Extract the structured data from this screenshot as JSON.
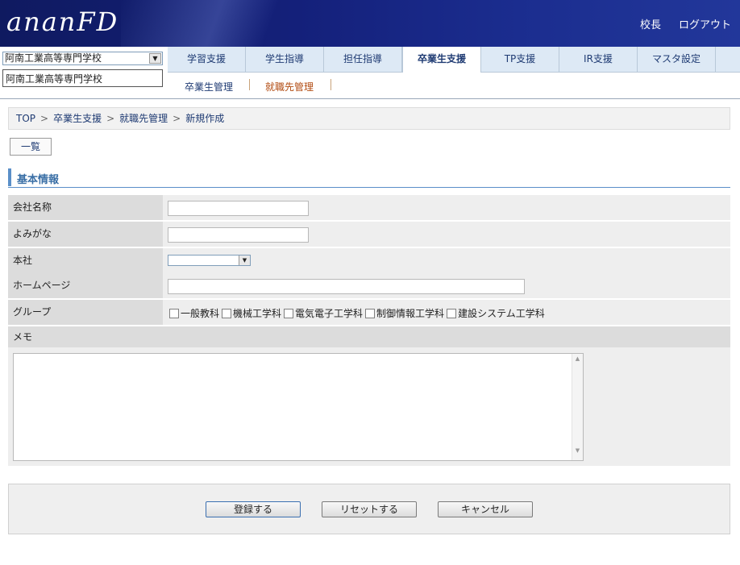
{
  "header": {
    "logo": "ananFD",
    "links": {
      "principal": "校長",
      "logout": "ログアウト"
    }
  },
  "school": {
    "select_value": "阿南工業高等専門学校",
    "name": "阿南工業高等専門学校"
  },
  "tabs": [
    "学習支援",
    "学生指導",
    "担任指導",
    "卒業生支援",
    "TP支援",
    "IR支援",
    "マスタ設定"
  ],
  "active_tab": "卒業生支援",
  "subnav": [
    "卒業生管理",
    "就職先管理"
  ],
  "breadcrumb": [
    "TOP",
    "卒業生支援",
    "就職先管理",
    "新規作成"
  ],
  "list_button": "一覧",
  "section_title": "基本情報",
  "form": {
    "company_name": {
      "label": "会社名称",
      "value": ""
    },
    "reading": {
      "label": "よみがな",
      "value": ""
    },
    "head_office": {
      "label": "本社",
      "value": ""
    },
    "homepage": {
      "label": "ホームページ",
      "value": ""
    },
    "group": {
      "label": "グループ",
      "options": [
        "一般教科",
        "機械工学科",
        "電気電子工学科",
        "制御情報工学科",
        "建設システム工学科"
      ]
    },
    "memo": {
      "label": "メモ",
      "value": ""
    }
  },
  "buttons": {
    "register": "登録する",
    "reset": "リセットする",
    "cancel": "キャンセル"
  }
}
